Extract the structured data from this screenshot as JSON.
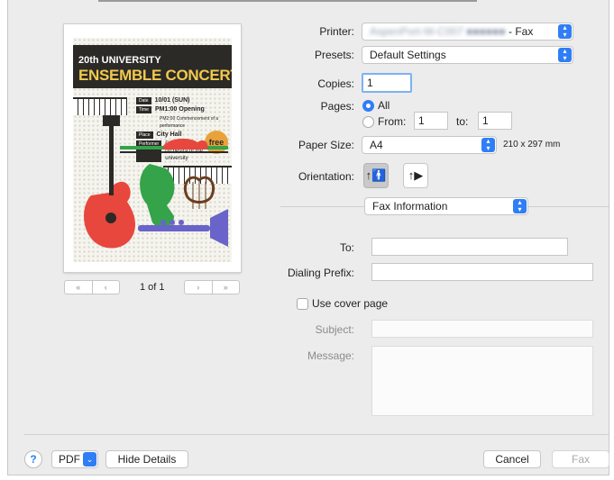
{
  "preview": {
    "poster": {
      "line1": "20th UNIVERSITY",
      "line2": "ENSEMBLE CONCERT",
      "date_tag": "Date",
      "date": "10/01 (SUN)",
      "time_tag": "Time",
      "time1": "PM1:00 Opening",
      "time2": "PM2:00 Commencement of a performance",
      "place_tag": "Place",
      "place": "City Hall",
      "performer_tag": "Performer",
      "performer": "Ensemble orchestra of the university",
      "free": "free"
    },
    "nav_first": "«",
    "nav_prev": "‹",
    "nav_next": "›",
    "nav_last": "»",
    "page_indicator": "1 of 1"
  },
  "printer": {
    "label": "Printer:",
    "value_redacted": "AspenPort-W-C007 ■■■■■■",
    "suffix": "- Fax"
  },
  "presets": {
    "label": "Presets:",
    "value": "Default Settings"
  },
  "copies": {
    "label": "Copies:",
    "value": "1"
  },
  "pages": {
    "label": "Pages:",
    "all": "All",
    "from": "From:",
    "from_value": "1",
    "to": "to:",
    "to_value": "1"
  },
  "paper": {
    "label": "Paper Size:",
    "value": "A4",
    "dimensions": "210 x 297 mm"
  },
  "orientation": {
    "label": "Orientation:"
  },
  "section": {
    "value": "Fax Information"
  },
  "fax": {
    "to_label": "To:",
    "prefix_label": "Dialing Prefix:",
    "cover_label": "Use cover page",
    "subject_label": "Subject:",
    "message_label": "Message:"
  },
  "footer": {
    "help": "?",
    "pdf": "PDF",
    "hide_details": "Hide Details",
    "cancel": "Cancel",
    "fax": "Fax"
  },
  "colors": {
    "accent": "#2f7ef6",
    "poster_dark": "#2b2a27",
    "poster_yellow": "#f2c94c",
    "poster_orange": "#e9a23a"
  }
}
